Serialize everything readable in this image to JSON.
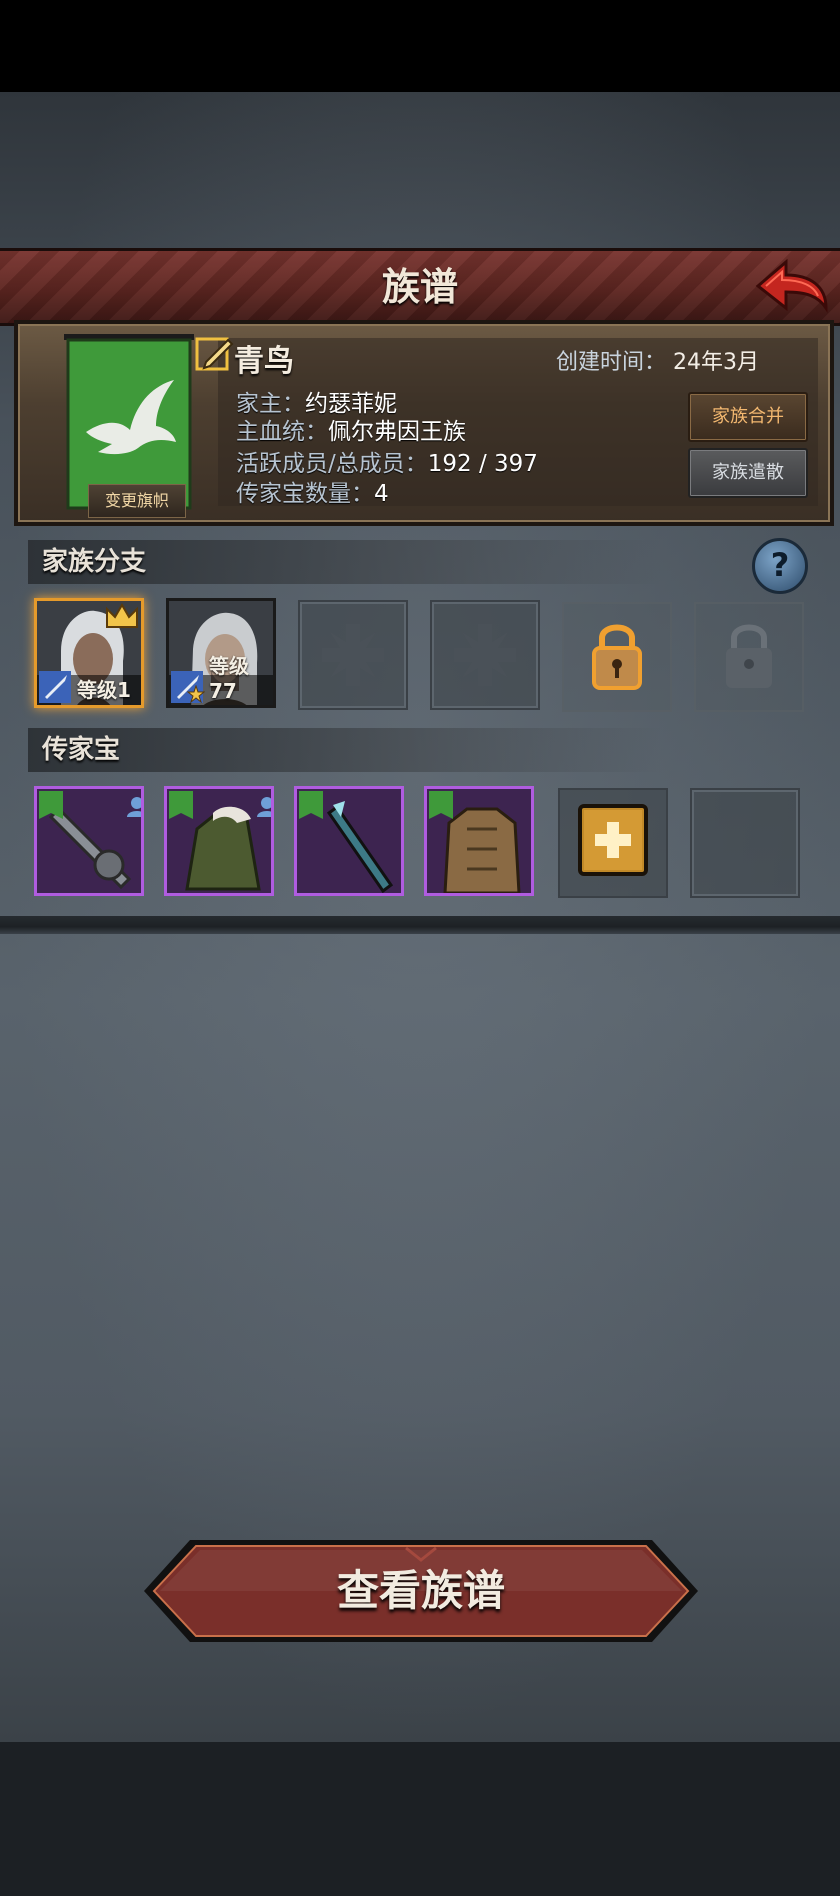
{
  "header": {
    "title": "族谱"
  },
  "family": {
    "name": "青鸟",
    "change_banner_label": "变更旗帜",
    "created_label": "创建时间：",
    "created_value": "24年3月",
    "head_label": "家主：",
    "head_value": "约瑟菲妮",
    "bloodline_label": "主血统：",
    "bloodline_value": "佩尔弗因王族",
    "members_label": "活跃成员/总成员：",
    "members_value": "192 / 397",
    "heirloom_count_label": "传家宝数量：",
    "heirloom_count_value": "4",
    "merge_label": "家族合并",
    "disband_label": "家族遣散",
    "banner_color": "#3f9a3a"
  },
  "branches": {
    "title": "家族分支",
    "members": [
      {
        "level_text": "等级1",
        "leader": true,
        "icon": "crown-icon"
      },
      {
        "level_text": "等级77",
        "leader": false,
        "icon": "star-icon"
      }
    ],
    "slots": [
      "empty-cross",
      "empty-cross",
      "locked-active",
      "locked"
    ]
  },
  "heirlooms": {
    "title": "传家宝",
    "items": [
      {
        "name": "greatsword-heirloom",
        "equipped_by_user": true
      },
      {
        "name": "coat-heirloom",
        "equipped_by_user": true
      },
      {
        "name": "spear-heirloom",
        "equipped_by_user": false
      },
      {
        "name": "armor-heirloom",
        "equipped_by_user": false
      }
    ],
    "add_icon": "plus-icon",
    "rarity_color": "#b05ce0"
  },
  "footer": {
    "view_label": "查看族谱"
  }
}
